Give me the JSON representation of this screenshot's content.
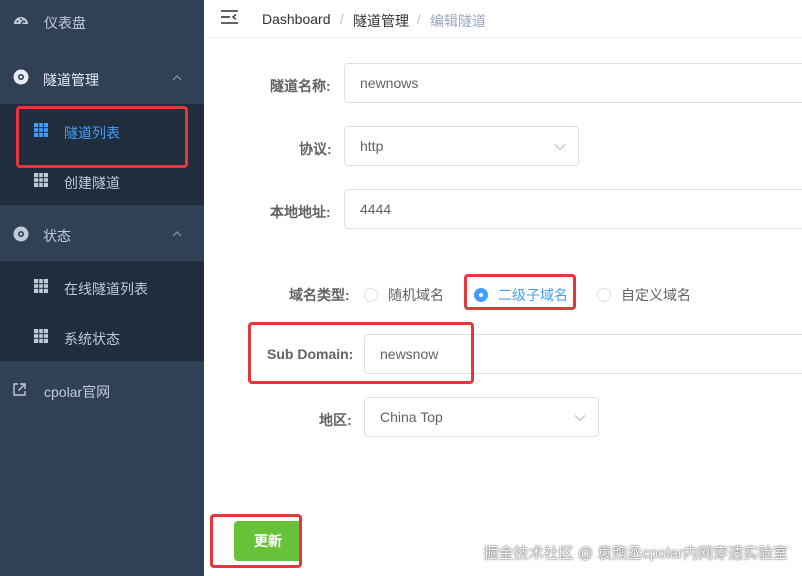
{
  "sidebar": {
    "dashboard": {
      "label": "仪表盘",
      "icon": "dashboard-icon"
    },
    "tunnel_group": {
      "label": "隧道管理",
      "icon": "gear-circle-icon"
    },
    "tunnel_list": {
      "label": "隧道列表",
      "icon": "table-icon",
      "active": true
    },
    "create_tunnel": {
      "label": "创建隧道",
      "icon": "table-icon"
    },
    "status_group": {
      "label": "状态",
      "icon": "gear-circle-icon"
    },
    "online_tunnels": {
      "label": "在线隧道列表",
      "icon": "table-icon"
    },
    "system_status": {
      "label": "系统状态",
      "icon": "table-icon"
    },
    "cpolar_site": {
      "label": "cpolar官网",
      "icon": "external-link-icon"
    }
  },
  "breadcrumb": {
    "items": [
      "Dashboard",
      "隧道管理",
      "编辑隧道"
    ],
    "separator": "/"
  },
  "form": {
    "tunnel_name": {
      "label": "隧道名称:",
      "value": "newnows"
    },
    "protocol": {
      "label": "协议:",
      "value": "http"
    },
    "local_address": {
      "label": "本地地址:",
      "value": "4444"
    },
    "domain_type": {
      "label": "域名类型:",
      "options": [
        "随机域名",
        "二级子域名",
        "自定义域名"
      ],
      "selected": "二级子域名"
    },
    "sub_domain": {
      "label": "Sub Domain:",
      "value": "newsnow"
    },
    "region": {
      "label": "地区:",
      "value": "China Top"
    },
    "submit_label": "更新"
  },
  "watermark": "掘金技术社区 @ 袁煦丞cpolar内网穿透实验室",
  "colors": {
    "sidebar_bg": "#304156",
    "submenu_bg": "#1f2d3d",
    "active_text": "#409eff",
    "button_green": "#67c23a",
    "highlight_red": "#e5363c"
  }
}
